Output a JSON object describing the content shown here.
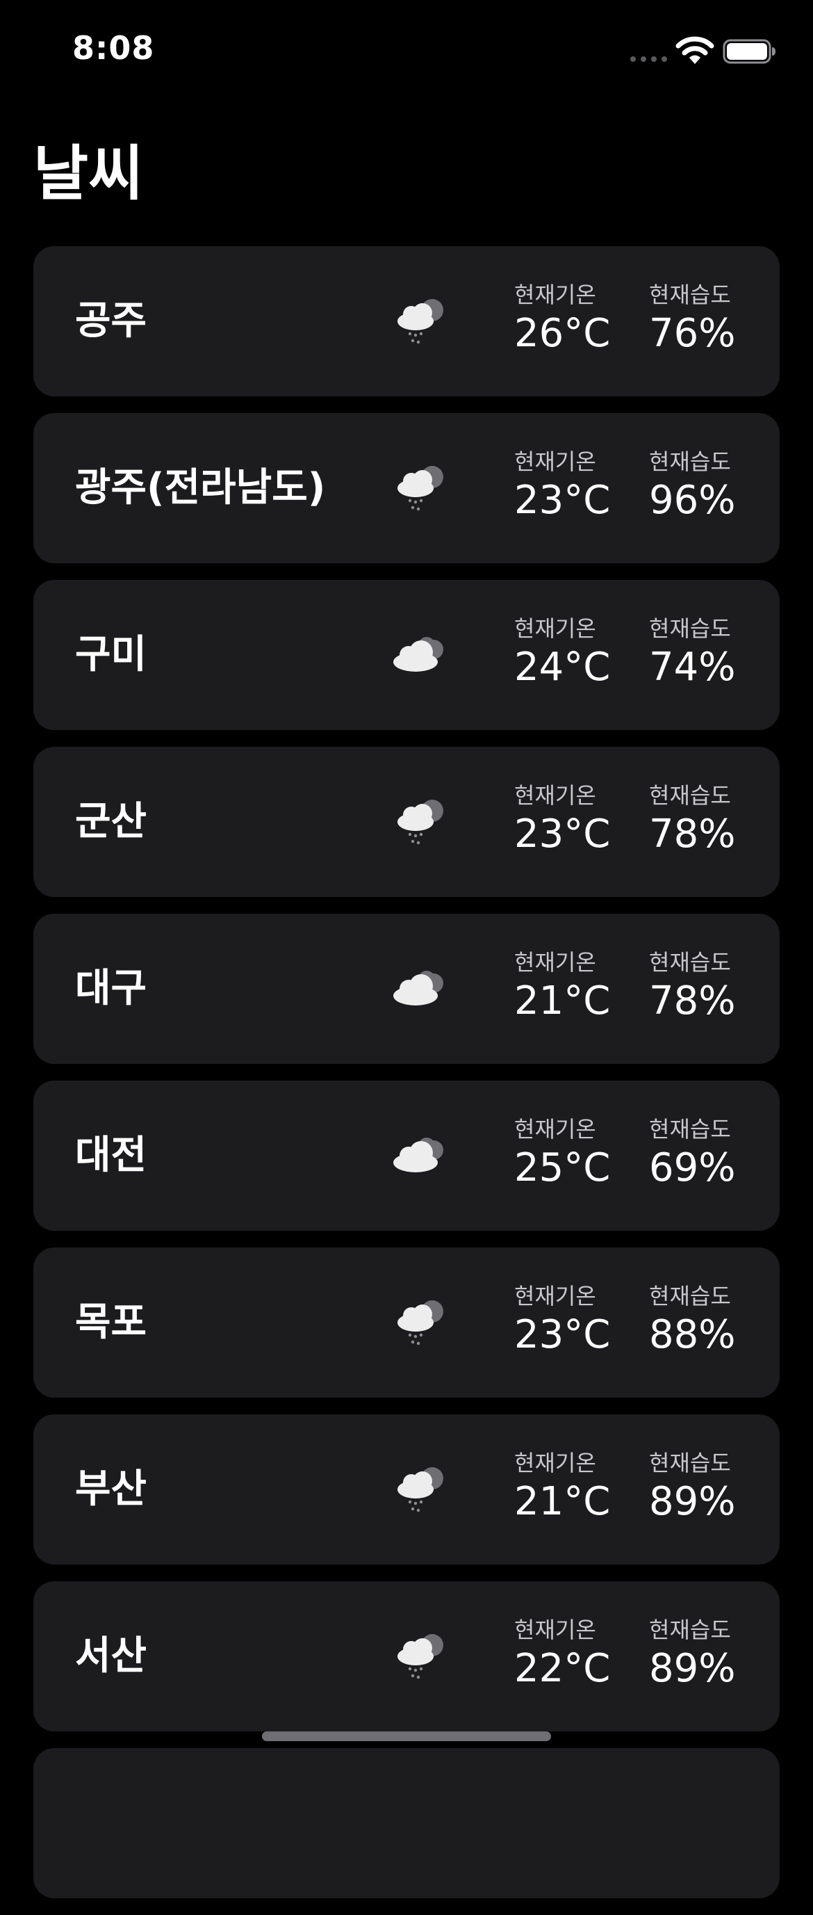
{
  "status_bar": {
    "time": "8:08"
  },
  "title": "날씨",
  "stat_labels": {
    "temperature": "현재기온",
    "humidity": "현재습도"
  },
  "cities": [
    {
      "name": "공주",
      "icon": "cloud-rain-icon",
      "temperature": "26°C",
      "humidity": "76%"
    },
    {
      "name": "광주(전라남도)",
      "icon": "cloud-rain-icon",
      "temperature": "23°C",
      "humidity": "96%"
    },
    {
      "name": "구미",
      "icon": "cloudy-icon",
      "temperature": "24°C",
      "humidity": "74%"
    },
    {
      "name": "군산",
      "icon": "cloud-rain-icon",
      "temperature": "23°C",
      "humidity": "78%"
    },
    {
      "name": "대구",
      "icon": "cloudy-icon",
      "temperature": "21°C",
      "humidity": "78%"
    },
    {
      "name": "대전",
      "icon": "cloudy-icon",
      "temperature": "25°C",
      "humidity": "69%"
    },
    {
      "name": "목포",
      "icon": "cloud-rain-icon",
      "temperature": "23°C",
      "humidity": "88%"
    },
    {
      "name": "부산",
      "icon": "cloud-rain-icon",
      "temperature": "21°C",
      "humidity": "89%"
    },
    {
      "name": "서산",
      "icon": "cloud-rain-icon",
      "temperature": "22°C",
      "humidity": "89%"
    }
  ]
}
